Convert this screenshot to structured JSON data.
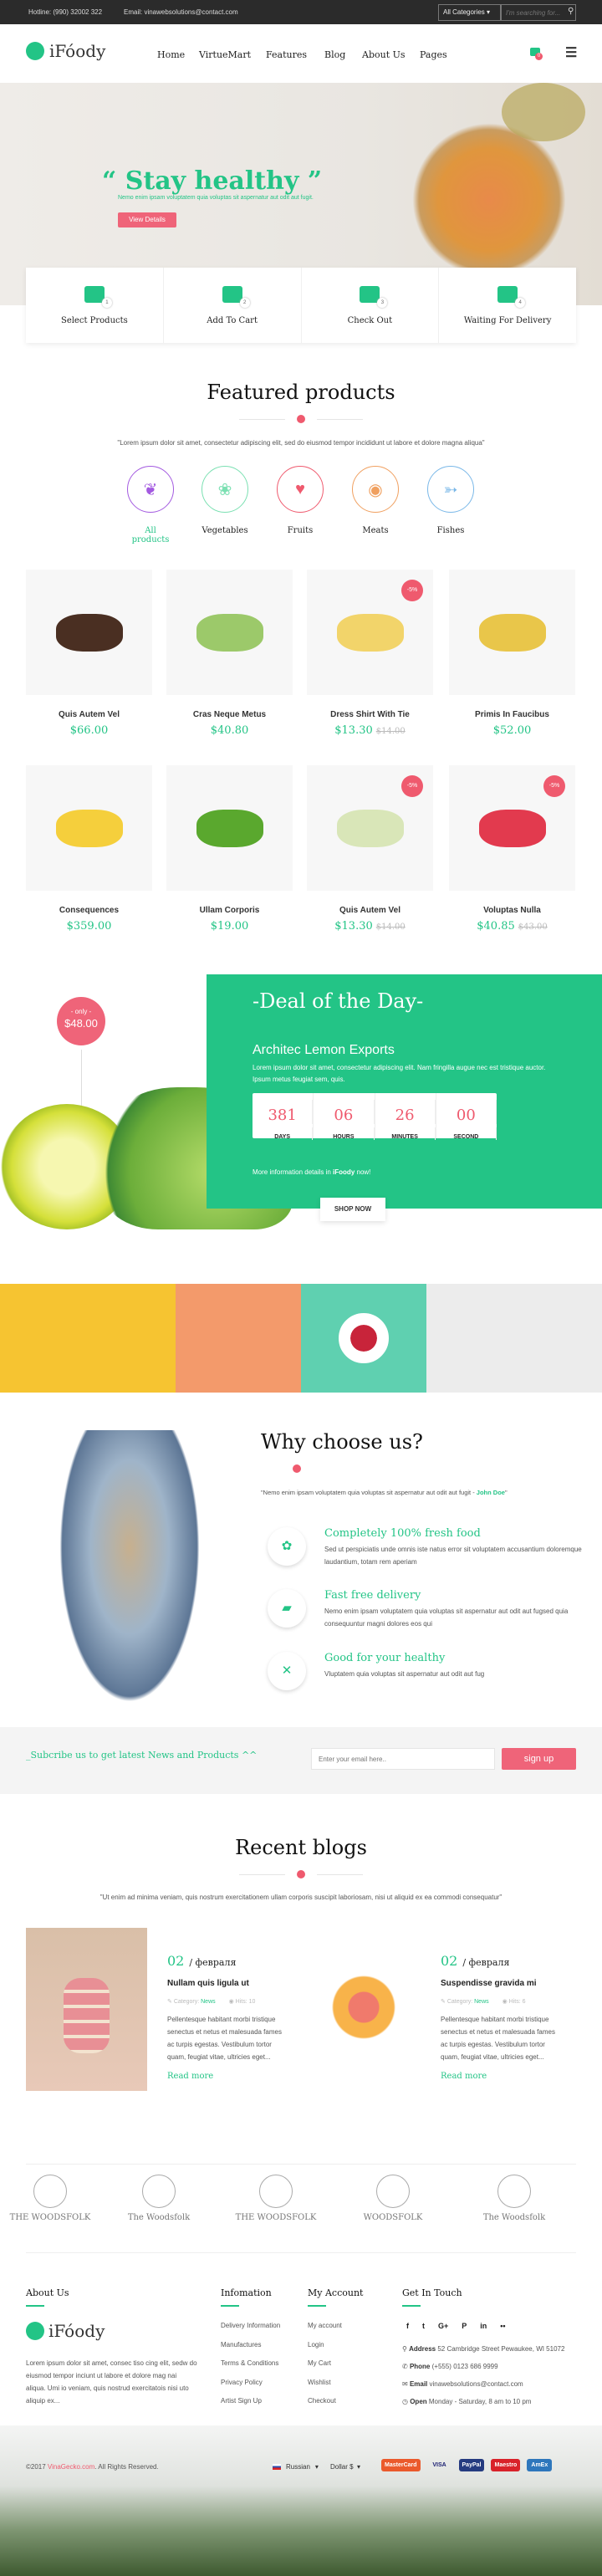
{
  "topbar": {
    "hotline": "Hotline: (990) 32002 322",
    "email": "Email: vinawebsolutions@contact.com",
    "category_select": "All Categories",
    "search_placeholder": "I'm searching for..."
  },
  "header": {
    "logo": "iFóody",
    "nav": [
      "Home",
      "VirtueMart",
      "Features",
      "Blog",
      "About Us",
      "Pages"
    ],
    "cart_count": "0"
  },
  "hero": {
    "title": "“ Stay healthy ”",
    "subtitle": "Nemo enim ipsam voluptatem quia voluptas sit aspernatur aut odit aut fugit.",
    "button": "View Details"
  },
  "steps": [
    {
      "label": "Select Products",
      "num": "1",
      "icon": "gift-icon"
    },
    {
      "label": "Add To Cart",
      "num": "2",
      "icon": "cart-plus-icon"
    },
    {
      "label": "Check Out",
      "num": "3",
      "icon": "dollar-icon"
    },
    {
      "label": "Waiting For Delivery",
      "num": "4",
      "icon": "truck-icon"
    }
  ],
  "featured": {
    "title": "Featured products",
    "subtitle": "\"Lorem ipsum dolor sit amet, consectetur adipiscing elit, sed do eiusmod tempor incididunt ut labore et dolore magna aliqua\"",
    "categories": [
      {
        "label": "All products",
        "color": "#a35ae0",
        "icon": "grapes-icon",
        "active": true
      },
      {
        "label": "Vegetables",
        "color": "#7be0b2",
        "icon": "broccoli-icon"
      },
      {
        "label": "Fruits",
        "color": "#ef5a6e",
        "icon": "strawberry-icon"
      },
      {
        "label": "Meats",
        "color": "#f0a060",
        "icon": "steak-icon"
      },
      {
        "label": "Fishes",
        "color": "#7ab8e8",
        "icon": "fish-icon"
      }
    ],
    "products": [
      {
        "name": "Quis Autem Vel",
        "price": "$66.00",
        "color": "#4a2f22"
      },
      {
        "name": "Cras Neque Metus",
        "price": "$40.80",
        "color": "#9cc96a"
      },
      {
        "name": "Dress Shirt With Tie",
        "price": "$13.30",
        "old": "$14.00",
        "badge": "-5%",
        "color": "#f2d46a"
      },
      {
        "name": "Primis In Faucibus",
        "price": "$52.00",
        "color": "#e9c64a"
      },
      {
        "name": "Consequences",
        "price": "$359.00",
        "color": "#f5cf3c"
      },
      {
        "name": "Ullam Corporis",
        "price": "$19.00",
        "color": "#5aa82e"
      },
      {
        "name": "Quis Autem Vel",
        "price": "$13.30",
        "old": "$14.00",
        "badge": "-5%",
        "color": "#d9e6b8"
      },
      {
        "name": "Voluptas Nulla",
        "price": "$40.85",
        "old": "$43.00",
        "badge": "-5%",
        "color": "#e23a4e"
      }
    ]
  },
  "deal": {
    "badge_top": "- only -",
    "badge_price": "$48.00",
    "title": "-Deal of the Day-",
    "product": "Architec Lemon Exports",
    "desc": "Lorem ipsum dolor sit amet, consectetur adipiscing elit. Nam fringilla augue nec est tristique auctor. Ipsum metus feugiat sem, quis.",
    "countdown": [
      {
        "v": "381",
        "u": "DAYS"
      },
      {
        "v": "06",
        "u": "HOURS"
      },
      {
        "v": "26",
        "u": "MINUTES"
      },
      {
        "v": "00",
        "u": "SECOND"
      }
    ],
    "more_pre": "More information details in ",
    "more_brand": "iFoody",
    "more_post": " now!",
    "button": "SHOP NOW"
  },
  "strip_colors": [
    "#f6c431",
    "#f39a6b",
    "#5fd0b0",
    "#ececec"
  ],
  "why": {
    "title": "Why choose us?",
    "quote": "\"Nemo enim ipsam voluptatem quia voluptas sit aspernatur aut odit aut fugit - ",
    "author": "John Doe",
    "quote_end": "\"",
    "items": [
      {
        "title": "Completely 100% fresh food",
        "text": "Sed ut perspiciatis unde omnis iste natus error sit voluptatem accusantium doloremque laudantium, totam rem aperiam",
        "icon": "flower-icon"
      },
      {
        "title": "Fast free delivery",
        "text": "Nemo enim ipsam voluptatem quia voluptas sit aspernatur aut odit aut fugsed quia consequuntur magni dolores eos qui",
        "icon": "truck-icon"
      },
      {
        "title": "Good for your healthy",
        "text": "Vluptatem quia voluptas sit aspernatur aut odit aut fug",
        "icon": "utensils-icon"
      }
    ]
  },
  "subscribe": {
    "text": "_Subcribe us to get latest News and Products ^^",
    "placeholder": "Enter your email here..",
    "button": "sign up"
  },
  "blogs": {
    "title": "Recent blogs",
    "subtitle": "\"Ut enim ad minima veniam, quis nostrum exercitationem ullam corporis suscipit laboriosam, nisi ut aliquid ex ea commodi consequatur\"",
    "posts": [
      {
        "day": "02",
        "month": "/ февраля",
        "title": "Nullam quis ligula ut",
        "cat_label": "Category:",
        "cat": "News",
        "hits": "Hits: 10",
        "text": "Pellentesque habitant morbi tristique senectus et netus et malesuada fames ac turpis egestas. Vestibulum tortor quam, feugiat vitae, ultricies eget...",
        "more": "Read more"
      },
      {
        "day": "02",
        "month": "/ февраля",
        "title": "Suspendisse gravida mi",
        "cat_label": "Category:",
        "cat": "News",
        "hits": "Hits: 6",
        "text": "Pellentesque habitant morbi tristique senectus et netus et malesuada fames ac turpis egestas. Vestibulum tortor quam, feugiat vitae, ultricies eget...",
        "more": "Read more"
      }
    ]
  },
  "brands": [
    "THE WOODSFOLK",
    "The Woodsfolk",
    "THE WOODSFOLK",
    "WOODSFOLK",
    "The Woodsfolk"
  ],
  "footer": {
    "about_title": "About Us",
    "logo": "iFóody",
    "about_text": "Lorem ipsum dolor sit amet, consec tiso cing elit, sedw do eiusmod tempor inciunt ut labore et dolore mag nai aliqua. Umi io veniam, quis nostrud exercitatois nisi uto aliquip ex...",
    "info_title": "Infomation",
    "info": [
      "Delivery Information",
      "Manufactures",
      "Terms & Conditions",
      "Privacy Policy",
      "Artist Sign Up"
    ],
    "account_title": "My Account",
    "account": [
      "My account",
      "Login",
      "My Cart",
      "Wishlist",
      "Checkout"
    ],
    "contact_title": "Get In Touch",
    "social": [
      "f",
      "t",
      "G+",
      "P",
      "in",
      "••"
    ],
    "contact": [
      {
        "k": "Address",
        "v": "52 Cambridge Street Pewaukee, WI 51072"
      },
      {
        "k": "Phone",
        "v": "(+555) 0123 686 9999"
      },
      {
        "k": "Email",
        "v": "vinawebsolutions@contact.com"
      },
      {
        "k": "Open",
        "v": "Monday - Saturday, 8 am to 10 pm"
      }
    ],
    "copy_pre": "©2017 ",
    "copy_link": "VinaGecko.com",
    "copy_post": ". All Rights Reserved.",
    "language": "Russian",
    "currency": "Dollar $",
    "payments": [
      "MasterCard",
      "VISA",
      "PayPal",
      "Maestro",
      "AmEx"
    ]
  }
}
